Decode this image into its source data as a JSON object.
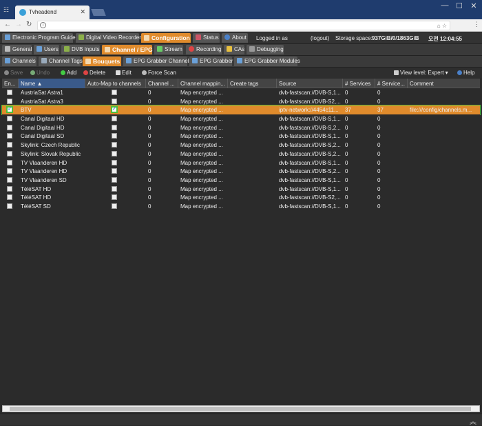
{
  "browser": {
    "tab_title": "Tvheadend",
    "window_controls": [
      "minimize",
      "maximize",
      "close"
    ],
    "url": ""
  },
  "appbar": {
    "tabs": [
      {
        "label": "Electronic Program Guide",
        "icon": "epg-icon"
      },
      {
        "label": "Digital Video Recorder",
        "icon": "dvr-icon"
      },
      {
        "label": "Configuration",
        "icon": "wrench-icon"
      },
      {
        "label": "Status",
        "icon": "status-icon"
      },
      {
        "label": "About",
        "icon": "info-icon"
      }
    ],
    "logged_in": "Logged in as",
    "logout": "(logout)",
    "storage_label": "Storage space:",
    "storage_value": "937GiB/0/1863GiB",
    "time": "오전 12:04:55"
  },
  "subtabs": [
    {
      "label": "General"
    },
    {
      "label": "Users"
    },
    {
      "label": "DVB Inputs"
    },
    {
      "label": "Channel / EPG"
    },
    {
      "label": "Stream"
    },
    {
      "label": "Recording"
    },
    {
      "label": "CAs"
    },
    {
      "label": "Debugging"
    }
  ],
  "subtabs2": [
    {
      "label": "Channels"
    },
    {
      "label": "Channel Tags"
    },
    {
      "label": "Bouquets"
    },
    {
      "label": "EPG Grabber Channels"
    },
    {
      "label": "EPG Grabber"
    },
    {
      "label": "EPG Grabber Modules"
    }
  ],
  "gridtools": {
    "save": "Save",
    "undo": "Undo",
    "add": "Add",
    "delete": "Delete",
    "edit": "Edit",
    "force_scan": "Force Scan",
    "view_level": "View level: Expert",
    "help": "Help"
  },
  "columns": [
    "En...",
    "Name",
    "Auto-Map to channels",
    "Channel ...",
    "Channel mappin...",
    "Create tags",
    "Source",
    "# Services",
    "# Service...",
    "Comment"
  ],
  "rows": [
    {
      "enabled": false,
      "name": "AustriaSat Astra1",
      "automap": false,
      "chnum": "0",
      "mapping": "Map encrypted ...",
      "tags": "",
      "source": "dvb-fastscan://DVB-S,1...",
      "services": "0",
      "services2": "0",
      "comment": ""
    },
    {
      "enabled": false,
      "name": "AustriaSat Astra3",
      "automap": false,
      "chnum": "0",
      "mapping": "Map encrypted ...",
      "tags": "",
      "source": "dvb-fastscan://DVB-S2,...",
      "services": "0",
      "services2": "0",
      "comment": ""
    },
    {
      "enabled": true,
      "name": "BTV",
      "automap": true,
      "chnum": "0",
      "mapping": "Map encrypted ...",
      "tags": "",
      "source": "iptv-network://4454c11...",
      "services": "37",
      "services2": "37",
      "comment": "file:///config/channels.m...",
      "selected": true
    },
    {
      "enabled": false,
      "name": "Canal Digitaal HD",
      "automap": false,
      "chnum": "0",
      "mapping": "Map encrypted ...",
      "tags": "",
      "source": "dvb-fastscan://DVB-S,1...",
      "services": "0",
      "services2": "0",
      "comment": ""
    },
    {
      "enabled": false,
      "name": "Canal Digitaal HD",
      "automap": false,
      "chnum": "0",
      "mapping": "Map encrypted ...",
      "tags": "",
      "source": "dvb-fastscan://DVB-S,2...",
      "services": "0",
      "services2": "0",
      "comment": ""
    },
    {
      "enabled": false,
      "name": "Canal Digitaal SD",
      "automap": false,
      "chnum": "0",
      "mapping": "Map encrypted ...",
      "tags": "",
      "source": "dvb-fastscan://DVB-S,1...",
      "services": "0",
      "services2": "0",
      "comment": ""
    },
    {
      "enabled": false,
      "name": "Skylink: Czech Republic",
      "automap": false,
      "chnum": "0",
      "mapping": "Map encrypted ...",
      "tags": "",
      "source": "dvb-fastscan://DVB-S,2...",
      "services": "0",
      "services2": "0",
      "comment": ""
    },
    {
      "enabled": false,
      "name": "Skylink: Slovak Republic",
      "automap": false,
      "chnum": "0",
      "mapping": "Map encrypted ...",
      "tags": "",
      "source": "dvb-fastscan://DVB-S,2...",
      "services": "0",
      "services2": "0",
      "comment": ""
    },
    {
      "enabled": false,
      "name": "TV Vlaanderen HD",
      "automap": false,
      "chnum": "0",
      "mapping": "Map encrypted ...",
      "tags": "",
      "source": "dvb-fastscan://DVB-S,1...",
      "services": "0",
      "services2": "0",
      "comment": ""
    },
    {
      "enabled": false,
      "name": "TV Vlaanderen HD",
      "automap": false,
      "chnum": "0",
      "mapping": "Map encrypted ...",
      "tags": "",
      "source": "dvb-fastscan://DVB-S,2...",
      "services": "0",
      "services2": "0",
      "comment": ""
    },
    {
      "enabled": false,
      "name": "TV Vlaanderen SD",
      "automap": false,
      "chnum": "0",
      "mapping": "Map encrypted ...",
      "tags": "",
      "source": "dvb-fastscan://DVB-S,1...",
      "services": "0",
      "services2": "0",
      "comment": ""
    },
    {
      "enabled": false,
      "name": "TéléSAT HD",
      "automap": false,
      "chnum": "0",
      "mapping": "Map encrypted ...",
      "tags": "",
      "source": "dvb-fastscan://DVB-S,1...",
      "services": "0",
      "services2": "0",
      "comment": ""
    },
    {
      "enabled": false,
      "name": "TéléSAT HD",
      "automap": false,
      "chnum": "0",
      "mapping": "Map encrypted ...",
      "tags": "",
      "source": "dvb-fastscan://DVB-S2,...",
      "services": "0",
      "services2": "0",
      "comment": ""
    },
    {
      "enabled": false,
      "name": "TéléSAT SD",
      "automap": false,
      "chnum": "0",
      "mapping": "Map encrypted ...",
      "tags": "",
      "source": "dvb-fastscan://DVB-S,1...",
      "services": "0",
      "services2": "0",
      "comment": ""
    }
  ],
  "colors": {
    "accent": "#e08b2c",
    "selection_outline": "#4fbf3a",
    "titlebar": "#1f3c6e"
  }
}
